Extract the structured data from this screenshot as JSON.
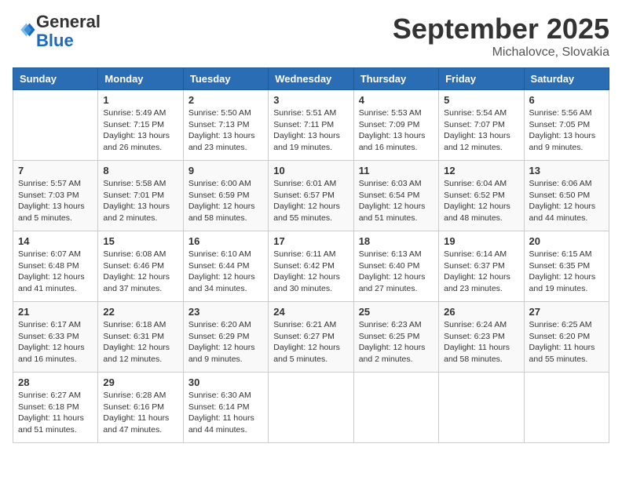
{
  "header": {
    "logo_line1": "General",
    "logo_line2": "Blue",
    "month": "September 2025",
    "location": "Michalovce, Slovakia"
  },
  "weekdays": [
    "Sunday",
    "Monday",
    "Tuesday",
    "Wednesday",
    "Thursday",
    "Friday",
    "Saturday"
  ],
  "weeks": [
    [
      {
        "day": "",
        "content": ""
      },
      {
        "day": "1",
        "content": "Sunrise: 5:49 AM\nSunset: 7:15 PM\nDaylight: 13 hours\nand 26 minutes."
      },
      {
        "day": "2",
        "content": "Sunrise: 5:50 AM\nSunset: 7:13 PM\nDaylight: 13 hours\nand 23 minutes."
      },
      {
        "day": "3",
        "content": "Sunrise: 5:51 AM\nSunset: 7:11 PM\nDaylight: 13 hours\nand 19 minutes."
      },
      {
        "day": "4",
        "content": "Sunrise: 5:53 AM\nSunset: 7:09 PM\nDaylight: 13 hours\nand 16 minutes."
      },
      {
        "day": "5",
        "content": "Sunrise: 5:54 AM\nSunset: 7:07 PM\nDaylight: 13 hours\nand 12 minutes."
      },
      {
        "day": "6",
        "content": "Sunrise: 5:56 AM\nSunset: 7:05 PM\nDaylight: 13 hours\nand 9 minutes."
      }
    ],
    [
      {
        "day": "7",
        "content": "Sunrise: 5:57 AM\nSunset: 7:03 PM\nDaylight: 13 hours\nand 5 minutes."
      },
      {
        "day": "8",
        "content": "Sunrise: 5:58 AM\nSunset: 7:01 PM\nDaylight: 13 hours\nand 2 minutes."
      },
      {
        "day": "9",
        "content": "Sunrise: 6:00 AM\nSunset: 6:59 PM\nDaylight: 12 hours\nand 58 minutes."
      },
      {
        "day": "10",
        "content": "Sunrise: 6:01 AM\nSunset: 6:57 PM\nDaylight: 12 hours\nand 55 minutes."
      },
      {
        "day": "11",
        "content": "Sunrise: 6:03 AM\nSunset: 6:54 PM\nDaylight: 12 hours\nand 51 minutes."
      },
      {
        "day": "12",
        "content": "Sunrise: 6:04 AM\nSunset: 6:52 PM\nDaylight: 12 hours\nand 48 minutes."
      },
      {
        "day": "13",
        "content": "Sunrise: 6:06 AM\nSunset: 6:50 PM\nDaylight: 12 hours\nand 44 minutes."
      }
    ],
    [
      {
        "day": "14",
        "content": "Sunrise: 6:07 AM\nSunset: 6:48 PM\nDaylight: 12 hours\nand 41 minutes."
      },
      {
        "day": "15",
        "content": "Sunrise: 6:08 AM\nSunset: 6:46 PM\nDaylight: 12 hours\nand 37 minutes."
      },
      {
        "day": "16",
        "content": "Sunrise: 6:10 AM\nSunset: 6:44 PM\nDaylight: 12 hours\nand 34 minutes."
      },
      {
        "day": "17",
        "content": "Sunrise: 6:11 AM\nSunset: 6:42 PM\nDaylight: 12 hours\nand 30 minutes."
      },
      {
        "day": "18",
        "content": "Sunrise: 6:13 AM\nSunset: 6:40 PM\nDaylight: 12 hours\nand 27 minutes."
      },
      {
        "day": "19",
        "content": "Sunrise: 6:14 AM\nSunset: 6:37 PM\nDaylight: 12 hours\nand 23 minutes."
      },
      {
        "day": "20",
        "content": "Sunrise: 6:15 AM\nSunset: 6:35 PM\nDaylight: 12 hours\nand 19 minutes."
      }
    ],
    [
      {
        "day": "21",
        "content": "Sunrise: 6:17 AM\nSunset: 6:33 PM\nDaylight: 12 hours\nand 16 minutes."
      },
      {
        "day": "22",
        "content": "Sunrise: 6:18 AM\nSunset: 6:31 PM\nDaylight: 12 hours\nand 12 minutes."
      },
      {
        "day": "23",
        "content": "Sunrise: 6:20 AM\nSunset: 6:29 PM\nDaylight: 12 hours\nand 9 minutes."
      },
      {
        "day": "24",
        "content": "Sunrise: 6:21 AM\nSunset: 6:27 PM\nDaylight: 12 hours\nand 5 minutes."
      },
      {
        "day": "25",
        "content": "Sunrise: 6:23 AM\nSunset: 6:25 PM\nDaylight: 12 hours\nand 2 minutes."
      },
      {
        "day": "26",
        "content": "Sunrise: 6:24 AM\nSunset: 6:23 PM\nDaylight: 11 hours\nand 58 minutes."
      },
      {
        "day": "27",
        "content": "Sunrise: 6:25 AM\nSunset: 6:20 PM\nDaylight: 11 hours\nand 55 minutes."
      }
    ],
    [
      {
        "day": "28",
        "content": "Sunrise: 6:27 AM\nSunset: 6:18 PM\nDaylight: 11 hours\nand 51 minutes."
      },
      {
        "day": "29",
        "content": "Sunrise: 6:28 AM\nSunset: 6:16 PM\nDaylight: 11 hours\nand 47 minutes."
      },
      {
        "day": "30",
        "content": "Sunrise: 6:30 AM\nSunset: 6:14 PM\nDaylight: 11 hours\nand 44 minutes."
      },
      {
        "day": "",
        "content": ""
      },
      {
        "day": "",
        "content": ""
      },
      {
        "day": "",
        "content": ""
      },
      {
        "day": "",
        "content": ""
      }
    ]
  ]
}
